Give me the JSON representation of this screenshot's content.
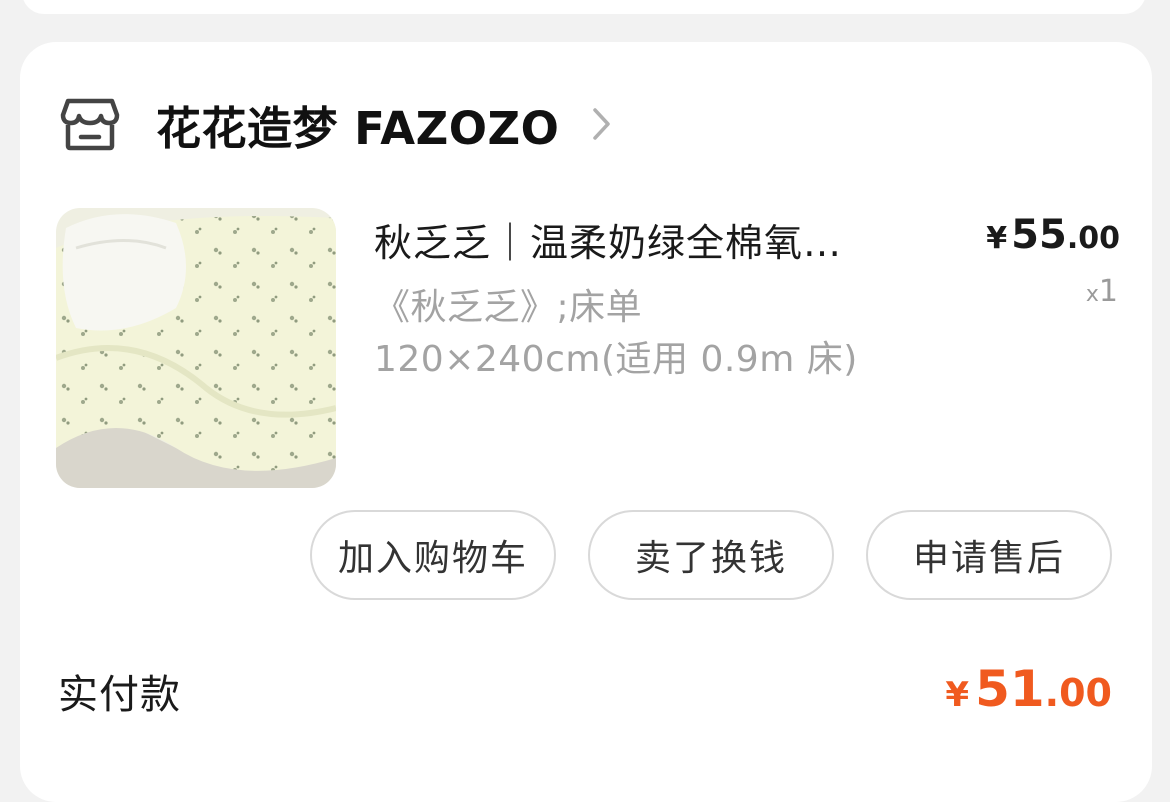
{
  "shop": {
    "name": "花花造梦 FAZOZO",
    "icon": "store-icon",
    "chevron_icon": "chevron-right-icon"
  },
  "product": {
    "title": "秋乏乏｜温柔奶绿全棉氧…",
    "spec_line1": "《秋乏乏》;床单",
    "spec_line2": "120×240cm(适用 0.9m 床)",
    "price_symbol": "¥",
    "price_int": "55",
    "price_dec": ".00",
    "qty_prefix": "x",
    "qty": "1",
    "image_icon": "product-photo-bedsheet"
  },
  "actions": {
    "add_to_cart": "加入购物车",
    "sell_for_cash": "卖了换钱",
    "after_sales": "申请售后"
  },
  "payment": {
    "label": "实付款",
    "symbol": "¥",
    "amount_int": "51",
    "amount_dec": ".00"
  },
  "colors": {
    "accent": "#f05a1f",
    "background": "#f2f2f2",
    "card": "#ffffff"
  }
}
